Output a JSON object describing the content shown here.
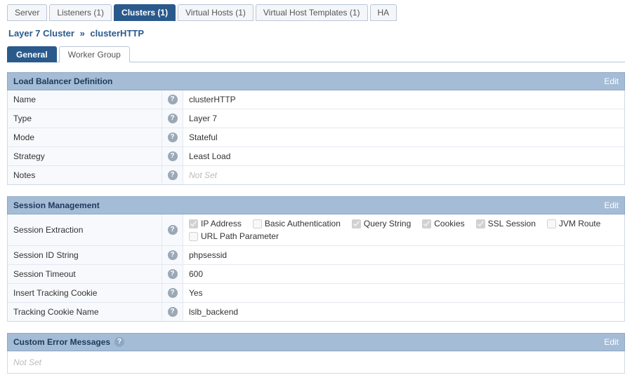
{
  "topTabs": [
    {
      "label": "Server",
      "active": false
    },
    {
      "label": "Listeners (1)",
      "active": false
    },
    {
      "label": "Clusters (1)",
      "active": true
    },
    {
      "label": "Virtual Hosts (1)",
      "active": false
    },
    {
      "label": "Virtual Host Templates (1)",
      "active": false
    },
    {
      "label": "HA",
      "active": false
    }
  ],
  "breadcrumb": {
    "part1": "Layer 7 Cluster",
    "sep": "»",
    "part2": "clusterHTTP"
  },
  "subTabs": [
    {
      "label": "General",
      "active": true
    },
    {
      "label": "Worker Group",
      "active": false
    }
  ],
  "editLabel": "Edit",
  "notSetLabel": "Not Set",
  "panels": {
    "definition": {
      "title": "Load Balancer Definition",
      "rows": {
        "name": {
          "label": "Name",
          "value": "clusterHTTP"
        },
        "type": {
          "label": "Type",
          "value": "Layer 7"
        },
        "mode": {
          "label": "Mode",
          "value": "Stateful"
        },
        "strategy": {
          "label": "Strategy",
          "value": "Least Load"
        },
        "notes": {
          "label": "Notes",
          "value": "Not Set",
          "placeholder": true
        }
      }
    },
    "session": {
      "title": "Session Management",
      "rows": {
        "extraction": {
          "label": "Session Extraction",
          "checks": [
            {
              "label": "IP Address",
              "checked": true
            },
            {
              "label": "Basic Authentication",
              "checked": false
            },
            {
              "label": "Query String",
              "checked": true
            },
            {
              "label": "Cookies",
              "checked": true
            },
            {
              "label": "SSL Session",
              "checked": true
            },
            {
              "label": "JVM Route",
              "checked": false
            },
            {
              "label": "URL Path Parameter",
              "checked": false
            }
          ]
        },
        "idstring": {
          "label": "Session ID String",
          "value": "phpsessid"
        },
        "timeout": {
          "label": "Session Timeout",
          "value": "600"
        },
        "insert": {
          "label": "Insert Tracking Cookie",
          "value": "Yes"
        },
        "cookie": {
          "label": "Tracking Cookie Name",
          "value": "lslb_backend"
        }
      }
    },
    "errors": {
      "title": "Custom Error Messages"
    }
  }
}
